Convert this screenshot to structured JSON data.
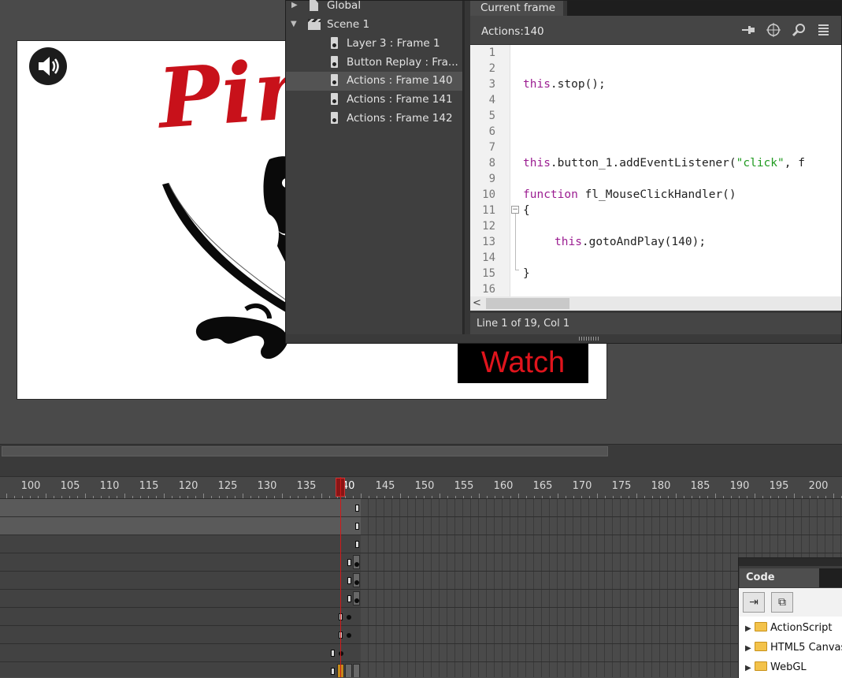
{
  "stage": {
    "title_text": "Pir",
    "watch_button_label": "Watch"
  },
  "actions_panel": {
    "tree": [
      {
        "label": "Global",
        "type": "doc"
      },
      {
        "label": "Scene 1",
        "type": "scene"
      },
      {
        "label": "Layer 3 : Frame 1",
        "type": "keyframe"
      },
      {
        "label": "Button Replay : Fra...",
        "type": "keyframe"
      },
      {
        "label": "Actions : Frame 140",
        "type": "keyframe",
        "selected": true
      },
      {
        "label": "Actions : Frame 141",
        "type": "keyframe"
      },
      {
        "label": "Actions : Frame 142",
        "type": "keyframe"
      }
    ],
    "tab_label": "Current frame",
    "header_label": "Actions:140",
    "toolbar_icons": [
      "pin-icon",
      "target-icon",
      "search-icon",
      "options-icon"
    ],
    "line_numbers": [
      "1",
      "2",
      "3",
      "4",
      "5",
      "6",
      "7",
      "8",
      "9",
      "10",
      "11",
      "12",
      "13",
      "14",
      "15",
      "16"
    ],
    "code": {
      "line3_obj": "this",
      "line3_rest": ".stop();",
      "line8_obj": "this",
      "line8_mid": ".button_1.addEventListener(",
      "line8_str": "\"click\"",
      "line8_rest": ", f",
      "line10_kw": "function",
      "line10_rest": " fl_MouseClickHandler()",
      "line11": "{",
      "line13_obj": "this",
      "line13_mid": ".gotoAndPlay(",
      "line13_num": "140",
      "line13_end": ");",
      "line15": "}"
    },
    "status": "Line 1 of 19, Col 1"
  },
  "timeline": {
    "ruler_labels": [
      "100",
      "105",
      "110",
      "115",
      "120",
      "125",
      "130",
      "135",
      "140",
      "145",
      "150",
      "155",
      "160",
      "165",
      "170",
      "175",
      "180",
      "185",
      "190",
      "195",
      "200"
    ],
    "current_frame": 140
  },
  "code_snippets": {
    "title": "Code Snippets",
    "folders": [
      "ActionScript",
      "HTML5 Canvas",
      "WebGL"
    ]
  },
  "colors": {
    "title_red": "#c8111a",
    "watch_red": "#e0141c",
    "playhead": "#d01a1a",
    "keyword": "#9b1d91",
    "string": "#1f9a1f"
  }
}
